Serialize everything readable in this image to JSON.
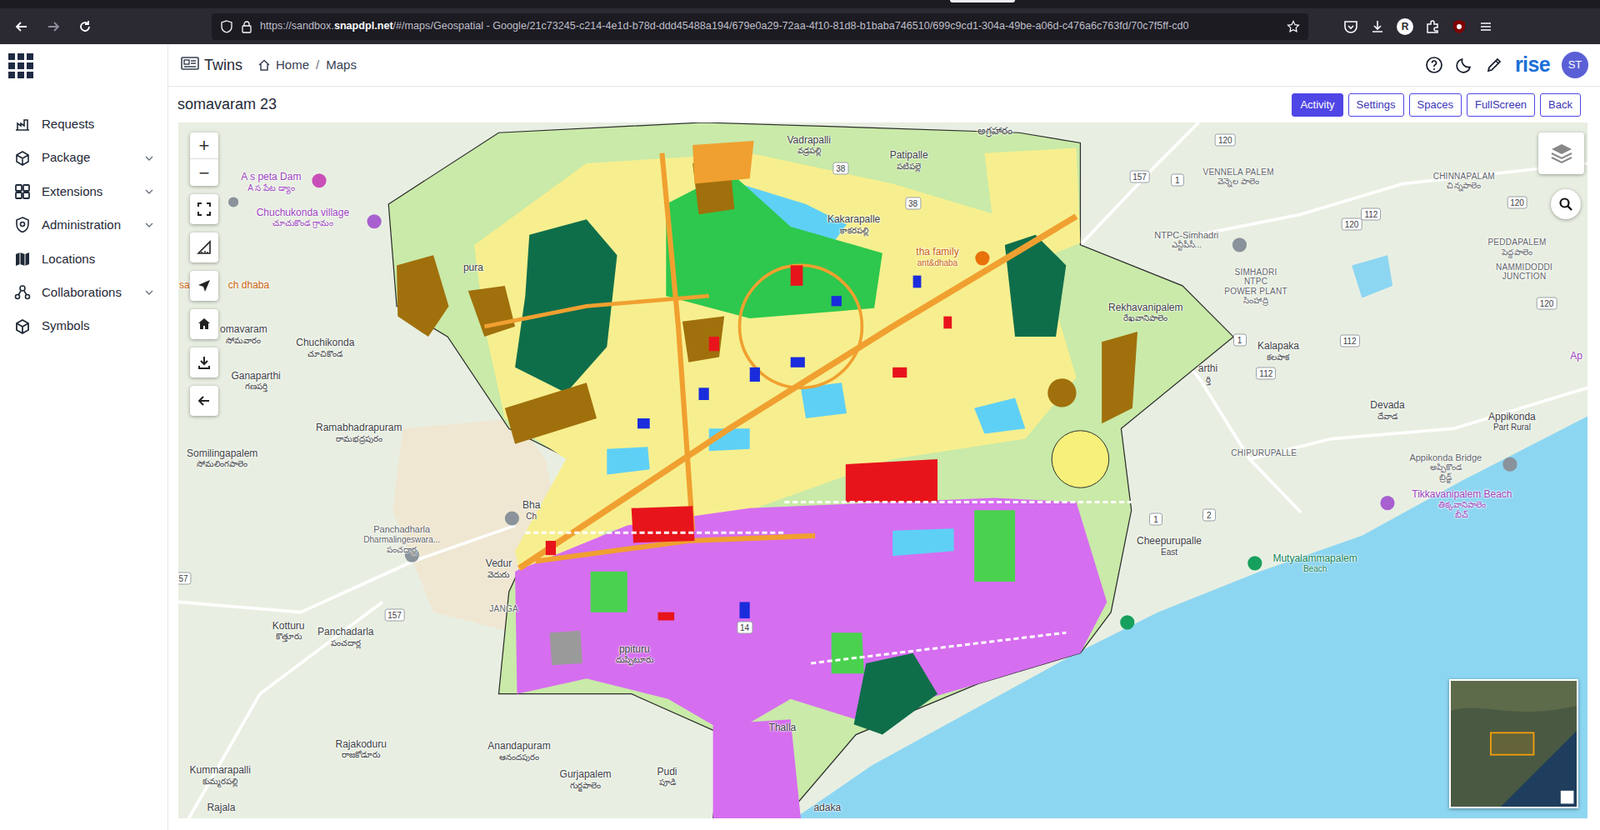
{
  "browser": {
    "url": {
      "prefix": "https://sandbox.",
      "host": "snapdpl.net",
      "path": "/#/maps/Geospatial - Google/21c73245-c214-4e1d-b78d-ddd45488a194/679e0a29-72aa-4f10-81d8-b1baba746510/699c9cd1-304a-49be-a06d-c476a6c763fd/70c7f5ff-cd0"
    },
    "profile": "R"
  },
  "header": {
    "app": "Twins",
    "breadcrumb": [
      "Home",
      "/",
      "Maps"
    ],
    "brand": "rise",
    "avatar": "ST"
  },
  "sidebar": {
    "items": [
      {
        "label": "Requests",
        "expandable": false
      },
      {
        "label": "Package",
        "expandable": true
      },
      {
        "label": "Extensions",
        "expandable": true
      },
      {
        "label": "Administration",
        "expandable": true
      },
      {
        "label": "Locations",
        "expandable": false
      },
      {
        "label": "Collaborations",
        "expandable": true
      },
      {
        "label": "Symbols",
        "expandable": false
      }
    ]
  },
  "page": {
    "title": "somavaram 23"
  },
  "buttons": [
    {
      "label": "Activity",
      "selected": true
    },
    {
      "label": "Settings",
      "selected": false
    },
    {
      "label": "Spaces",
      "selected": false
    },
    {
      "label": "FullScreen",
      "selected": false
    },
    {
      "label": "Back",
      "selected": false
    }
  ],
  "map": {
    "zoom_in": "+",
    "zoom_out": "−",
    "labels": [
      {
        "lines": [
          "A s peta Dam",
          "A స పేట డ్యాం"
        ],
        "kind": "poi-purple"
      },
      {
        "lines": [
          "Chuchukonda village",
          "చూచుకొండ గ్రామం"
        ],
        "kind": "poi-purple"
      },
      {
        "lines": [
          "Vadrapalli",
          "వడ్రపల్లి"
        ],
        "kind": "town"
      },
      {
        "lines": [
          "Patipalle",
          "పటిపల్లె"
        ],
        "kind": "town"
      },
      {
        "lines": [
          "Kakarapalle",
          "కాకరపల్లి"
        ],
        "kind": "town"
      },
      {
        "lines": [
          "అగ్రహారం"
        ],
        "kind": "town"
      },
      {
        "lines": [
          "tha family",
          "ant&dhaba"
        ],
        "kind": "poi-orange"
      },
      {
        "lines": [
          "VENNELA PALEM",
          "వెన్నెల పాలెం"
        ],
        "kind": "area"
      },
      {
        "lines": [
          "NTPC-Simhadri",
          "ఎన్టీపీసీ..."
        ],
        "kind": "poi-gray"
      },
      {
        "lines": [
          "SIMHADRI",
          "NTPC",
          "POWER PLANT",
          "సింహాద్రి"
        ],
        "kind": "area"
      },
      {
        "lines": [
          "CHINNAPALAM",
          "చిన్నపాలెం"
        ],
        "kind": "area"
      },
      {
        "lines": [
          "PEDDAPALEM",
          "పెద్దపాలెం"
        ],
        "kind": "area"
      },
      {
        "lines": [
          "NAMMIDODDI",
          "JUNCTION"
        ],
        "kind": "area"
      },
      {
        "lines": [
          "Rekhavanipalem",
          "రేఖవానిపాలెం"
        ],
        "kind": "town"
      },
      {
        "lines": [
          "Kalapaka",
          "కలపాక"
        ],
        "kind": "town"
      },
      {
        "lines": [
          "arthi",
          "ర్తి"
        ],
        "kind": "town"
      },
      {
        "lines": [
          "Devada",
          "దేవాడ"
        ],
        "kind": "town"
      },
      {
        "lines": [
          "Appikonda",
          "Part Rural"
        ],
        "kind": "town"
      },
      {
        "lines": [
          "CHIPURUPALLE"
        ],
        "kind": "area"
      },
      {
        "lines": [
          "Appikonda Bridge",
          "అప్పికొండ",
          "బ్రిడ్జ్"
        ],
        "kind": "poi-gray"
      },
      {
        "lines": [
          "Tikkavanipalem Beach",
          "తిక్కవానిపాలెం",
          "బీచ్"
        ],
        "kind": "poi-purple"
      },
      {
        "lines": [
          "Mutyalammapalem",
          "Beach"
        ],
        "kind": "poi-teal"
      },
      {
        "lines": [
          "Cheepurupalle",
          "East"
        ],
        "kind": "town"
      },
      {
        "lines": [
          "omavaram",
          "సోమవారం"
        ],
        "kind": "town"
      },
      {
        "lines": [
          "Chuchikonda",
          "చూచికొండ"
        ],
        "kind": "town"
      },
      {
        "lines": [
          "Ganaparthi",
          "గణపర్తి"
        ],
        "kind": "town"
      },
      {
        "lines": [
          "Ramabhadrapuram",
          "రామభద్రపురం"
        ],
        "kind": "town"
      },
      {
        "lines": [
          "Somilingapalem",
          "సోమలింగపాలెం"
        ],
        "kind": "town"
      },
      {
        "lines": [
          "Panchadharla",
          "Dharmalingeswara...",
          "పంచదార్ల"
        ],
        "kind": "poi-gray"
      },
      {
        "lines": [
          "Vedur",
          "వెదురు"
        ],
        "kind": "town"
      },
      {
        "lines": [
          "JANGA"
        ],
        "kind": "area"
      },
      {
        "lines": [
          "Kotturu",
          "కొత్తూరు"
        ],
        "kind": "town"
      },
      {
        "lines": [
          "Panchadarla",
          "పంచదార్ల"
        ],
        "kind": "town"
      },
      {
        "lines": [
          "ppituru",
          "దుప్పిటూరు"
        ],
        "kind": "town"
      },
      {
        "lines": [
          "Rajakoduru",
          "రాజకోడూరు"
        ],
        "kind": "town"
      },
      {
        "lines": [
          "Anandapuram",
          "ఆనందపురం"
        ],
        "kind": "town"
      },
      {
        "lines": [
          "Gurjapalem",
          "గుర్జపాలెం"
        ],
        "kind": "town"
      },
      {
        "lines": [
          "Pudi",
          "పూడి"
        ],
        "kind": "town"
      },
      {
        "lines": [
          "Kummarapalli",
          "కుమ్మరపల్లి"
        ],
        "kind": "town"
      },
      {
        "lines": [
          "Rajala"
        ],
        "kind": "town"
      },
      {
        "lines": [
          "Thalla"
        ],
        "kind": "town"
      },
      {
        "lines": [
          "adaka"
        ],
        "kind": "town"
      },
      {
        "lines": [
          "sa"
        ],
        "kind": "poi-orange"
      },
      {
        "lines": [
          "ch dhaba"
        ],
        "kind": "poi-orange"
      },
      {
        "lines": [
          "pura"
        ],
        "kind": "town"
      },
      {
        "lines": [
          "Ap"
        ],
        "kind": "poi-purple"
      },
      {
        "lines": [
          "Bha",
          "Ch"
        ],
        "kind": "town"
      }
    ],
    "shields": [
      "38",
      "38",
      "157",
      "1",
      "120",
      "120",
      "112",
      "120",
      "120",
      "112",
      "112",
      "1",
      "1",
      "2",
      "157",
      "57",
      "14"
    ]
  }
}
